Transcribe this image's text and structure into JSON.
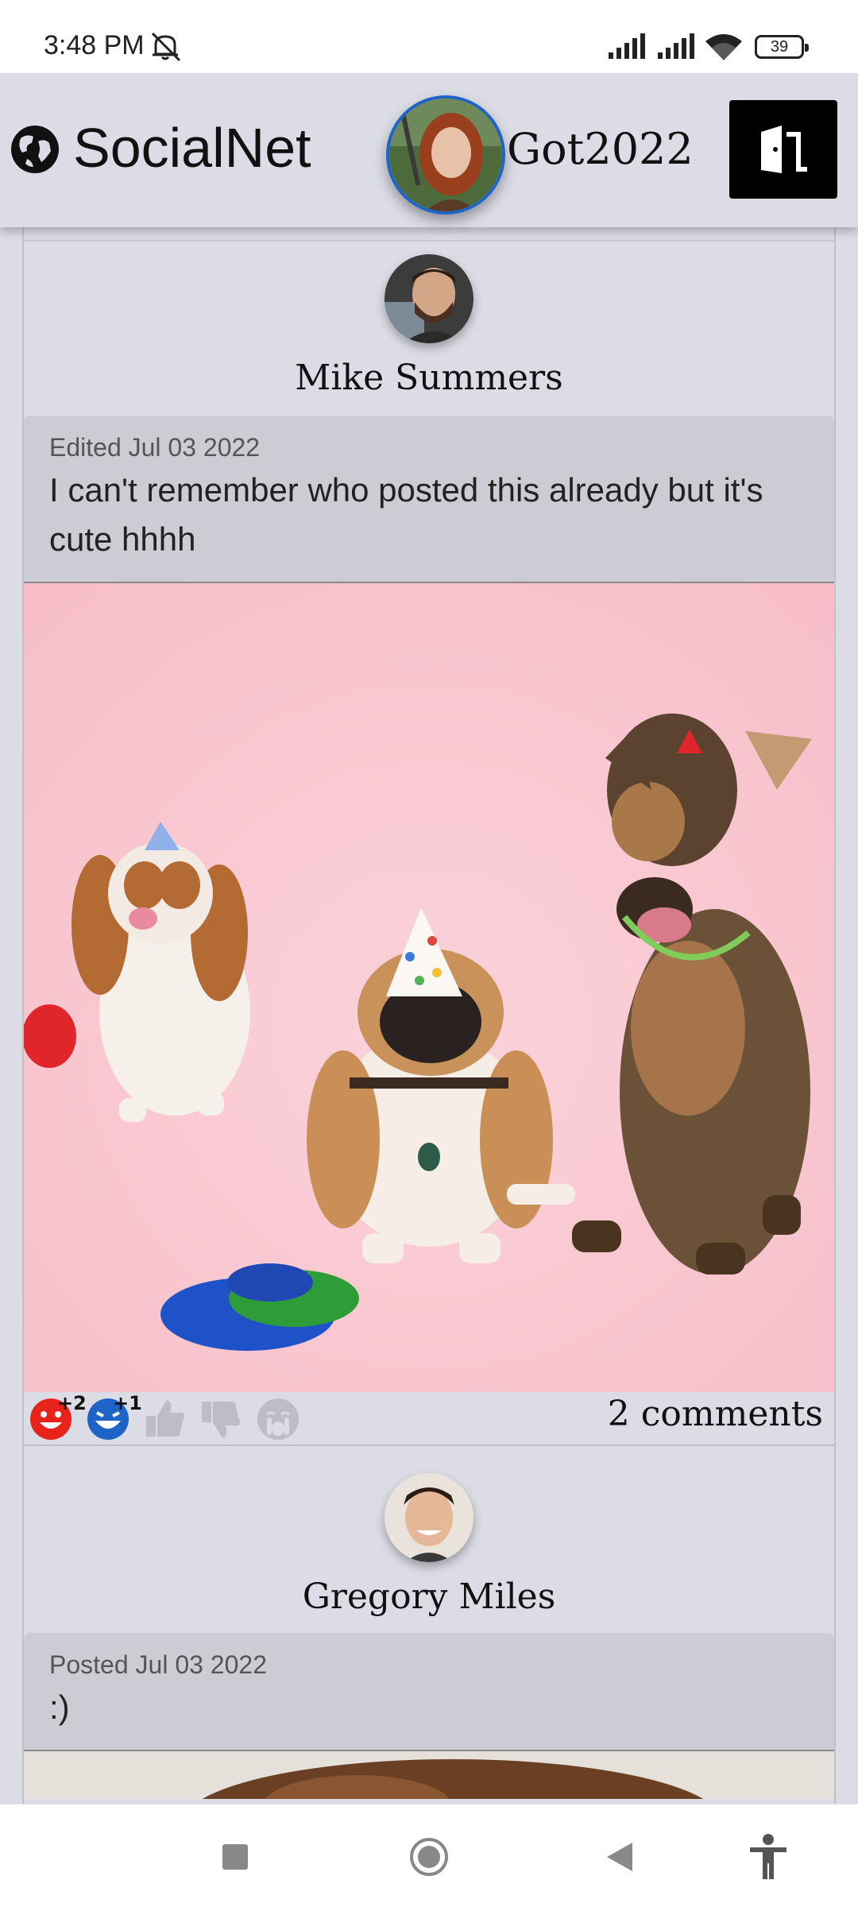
{
  "status_bar": {
    "time": "3:48 PM",
    "battery": "39",
    "icons": [
      "mute-icon",
      "signal-icon",
      "signal-icon",
      "wifi-icon",
      "battery-icon"
    ]
  },
  "header": {
    "brand": "SocialNet",
    "username": "Got2022",
    "icons": [
      "globe-icon",
      "logout-door-icon"
    ]
  },
  "posts": [
    {
      "author": "Mike Summers",
      "date": "Edited Jul 03 2022",
      "text": "I can't remember who posted this already but it's cute hhhh",
      "image": "photo of three dogs wearing party hats",
      "reactions": [
        {
          "name": "love",
          "count": "+2",
          "active": true,
          "color": "#e8231c"
        },
        {
          "name": "laugh",
          "count": "+1",
          "active": true,
          "color": "#1e63c8"
        },
        {
          "name": "like",
          "count": "",
          "active": false
        },
        {
          "name": "dislike",
          "count": "",
          "active": false
        },
        {
          "name": "cry",
          "count": "",
          "active": false
        }
      ],
      "comments": "2 comments"
    },
    {
      "author": "Gregory Miles",
      "date": "Posted Jul 03 2022",
      "text": ":)"
    }
  ],
  "colors": {
    "background": "#dcdce6",
    "text_box": "#ccccd4",
    "accent_blue": "#1e63c8",
    "accent_red": "#e8231c"
  },
  "nav": {
    "icons": [
      "recent-apps-icon",
      "home-icon",
      "back-icon",
      "accessibility-icon"
    ]
  }
}
